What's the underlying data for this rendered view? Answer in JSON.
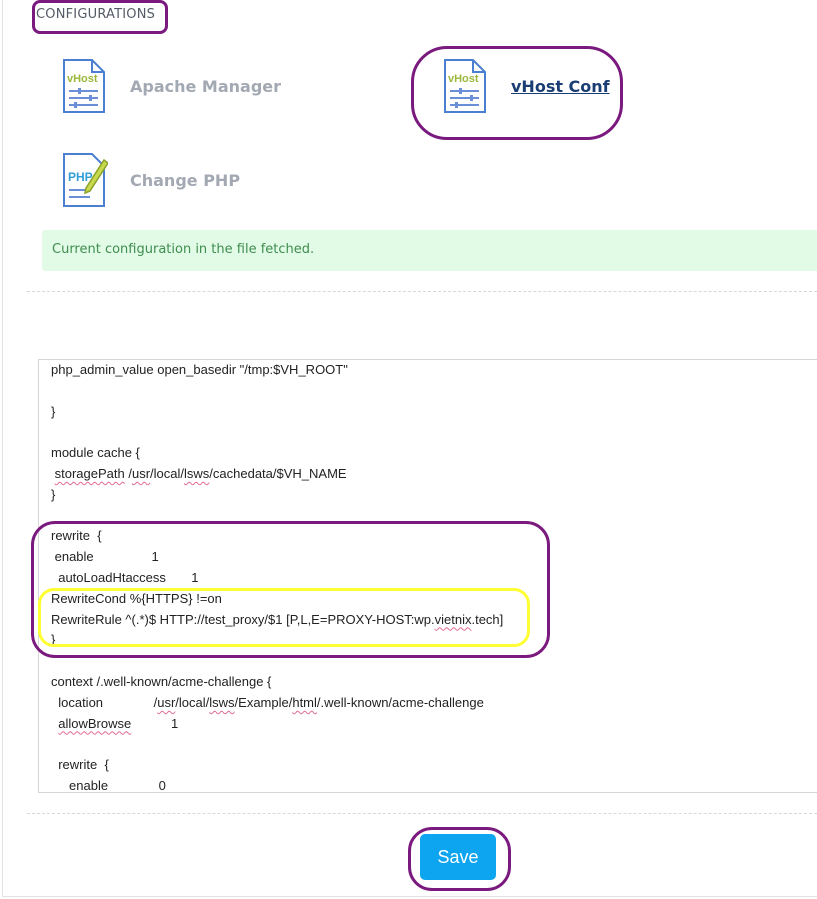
{
  "section": {
    "title": "CONFIGURATIONS"
  },
  "tools": [
    {
      "label": "Apache Manager",
      "icon": "vhost-file-icon",
      "icon_text": "vHost"
    },
    {
      "label": "vHost Conf",
      "icon": "vhost-file-icon",
      "icon_text": "vHost",
      "active": true
    },
    {
      "label": "Change PHP",
      "icon": "php-file-pencil-icon",
      "icon_text": "PHP"
    }
  ],
  "alert": {
    "message": "Current configuration in the file fetched."
  },
  "editor": {
    "lines": [
      "php_admin_value open_basedir \"/tmp:$VH_ROOT\"",
      "",
      "}",
      "",
      "module cache {",
      " storagePath /usr/local/lsws/cachedata/$VH_NAME",
      "}",
      "",
      "rewrite  {",
      " enable                1",
      "  autoLoadHtaccess       1",
      "RewriteCond %{HTTPS} !=on",
      "RewriteRule ^(.*)$ HTTP://test_proxy/$1 [P,L,E=PROXY-HOST:wp.vietnix.tech]",
      "}",
      "",
      "context /.well-known/acme-challenge {",
      "  location              /usr/local/lsws/Example/html/.well-known/acme-challenge",
      "  allowBrowse           1",
      "",
      "  rewrite  {",
      "     enable              0"
    ]
  },
  "save": {
    "label": "Save"
  },
  "colors": {
    "accent": "#0ea5f0",
    "annotation_purple": "#7b1a7e",
    "annotation_yellow": "#ffff33",
    "alert_bg": "#e1fbe6",
    "alert_text": "#3f8d4f"
  }
}
